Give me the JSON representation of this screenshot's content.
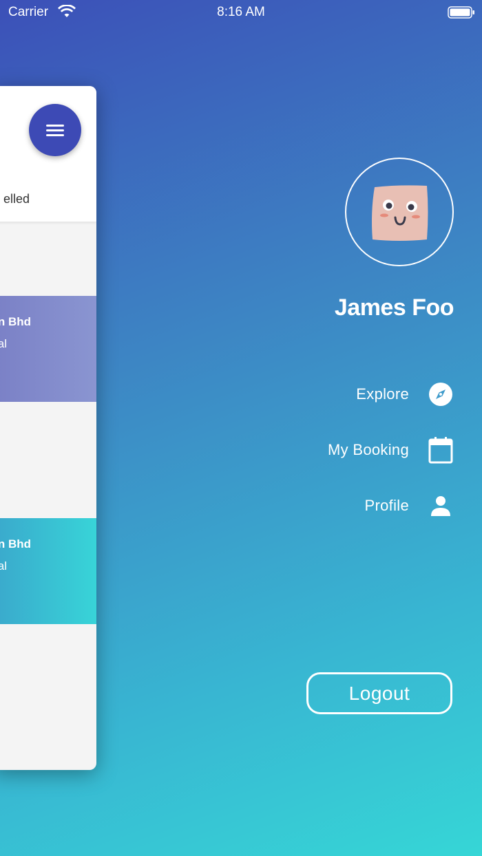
{
  "status_bar": {
    "carrier": "Carrier",
    "time": "8:16 AM"
  },
  "card": {
    "tab_label": "elled",
    "bookings": [
      {
        "title": "n Bhd",
        "subtitle": "al",
        "color": "#7f88cb"
      },
      {
        "title": "n Bhd",
        "subtitle": "al",
        "color": "#38c4d4"
      }
    ],
    "menu_button_color": "#3d4ab5"
  },
  "drawer": {
    "user_name": "James Foo",
    "menu": [
      {
        "label": "Explore",
        "icon": "compass-icon"
      },
      {
        "label": "My Booking",
        "icon": "calendar-icon"
      },
      {
        "label": "Profile",
        "icon": "person-icon"
      }
    ],
    "logout_label": "Logout"
  },
  "colors": {
    "gradient_top": "#3c50b8",
    "gradient_bottom": "#36d6d6",
    "avatar_skin": "#e8bfb4"
  }
}
